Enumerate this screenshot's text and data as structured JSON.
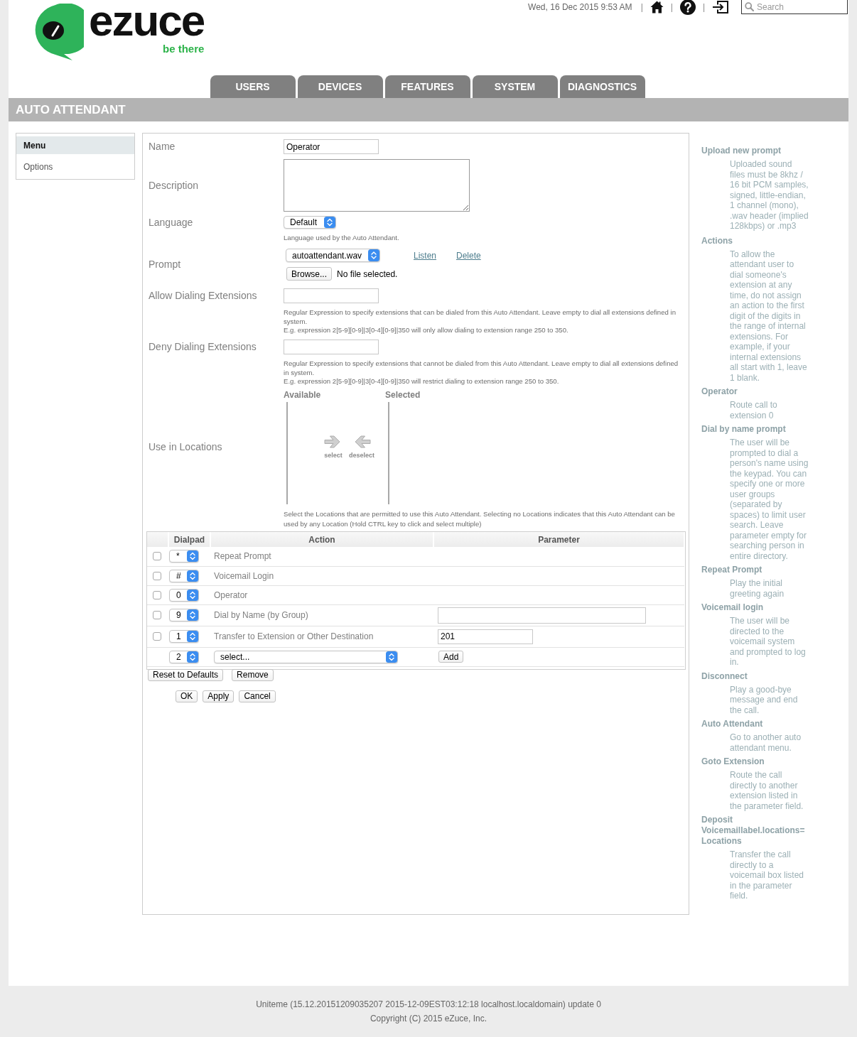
{
  "header": {
    "logo": {
      "wordmark": "ezuce",
      "tagline": "be there"
    },
    "datetime": "Wed, 16 Dec 2015 9:53 AM",
    "separators": [
      "|",
      "|",
      "|"
    ],
    "search": {
      "placeholder": "Search"
    }
  },
  "nav_tabs": [
    "USERS",
    "DEVICES",
    "FEATURES",
    "SYSTEM",
    "DIAGNOSTICS"
  ],
  "page_title": "AUTO ATTENDANT",
  "side_menu": [
    {
      "label": "Menu",
      "selected": true
    },
    {
      "label": "Options",
      "selected": false
    }
  ],
  "form": {
    "name": {
      "label": "Name",
      "value": "Operator"
    },
    "description": {
      "label": "Description"
    },
    "language": {
      "label": "Language",
      "value": "Default",
      "hint": "Language used by the Auto Attendant."
    },
    "prompt": {
      "label": "Prompt",
      "value": "autoattendant.wav",
      "links": [
        "Listen",
        "Delete"
      ],
      "browse_button": "Browse...",
      "file_status": "No file selected."
    },
    "allow_dialing_extensions": {
      "label": "Allow Dialing Extensions",
      "hint": [
        "Regular Expression to specify extensions that can be dialed from this Auto Attendant. Leave empty to dial all extensions defined in system.",
        "E.g. expression 2[5-9][0-9]|3[0-4][0-9]|350 will only allow dialing to extension range 250 to 350."
      ]
    },
    "deny_dialing_extensions": {
      "label": "Deny Dialing Extensions",
      "hint": [
        "Regular Expression to specify extensions that cannot be dialed from this Auto Attendant. Leave empty to dial all extensions defined in system.",
        "E.g. expression 2[5-9][0-9]|3[0-4][0-9]|350 will restrict dialing to extension range 250 to 350."
      ]
    },
    "locations": {
      "label": "Use in Locations",
      "available_heading": "Available",
      "selected_heading": "Selected",
      "select_button": "select",
      "deselect_button": "deselect",
      "hint": "Select the Locations that are permitted to use this Auto Attendant. Selecting no Locations indicates that this Auto Attendant can be used by any Location (Hold CTRL key to click and select multiple)"
    }
  },
  "dialpad_table": {
    "columns": [
      "Dialpad",
      "Action",
      "Parameter"
    ],
    "rows": [
      {
        "checked": false,
        "key": "*",
        "action": "Repeat Prompt",
        "kind": "plain"
      },
      {
        "checked": false,
        "key": "#",
        "action": "Voicemail Login",
        "kind": "plain"
      },
      {
        "checked": false,
        "key": "0",
        "action": "Operator",
        "kind": "plain"
      },
      {
        "checked": false,
        "key": "9",
        "action": "Dial by Name (by Group)",
        "kind": "groups"
      },
      {
        "checked": false,
        "key": "1",
        "action": "Transfer to Extension or Other Destination",
        "kind": "extension",
        "parameter": "201"
      }
    ],
    "new_entry": {
      "key": "2",
      "action": "select...",
      "add_button": "Add"
    },
    "buttons": [
      "Reset to Defaults",
      "Remove"
    ]
  },
  "form_buttons": [
    "OK",
    "Apply",
    "Cancel"
  ],
  "help": [
    {
      "title": "Upload new prompt",
      "text": "Uploaded sound files must be 8khz / 16 bit PCM samples, signed, little-endian, 1 channel (mono), .wav header (implied 128kbps) or .mp3"
    },
    {
      "title": "Actions",
      "text": "To allow the attendant user to dial someone's extension at any time, do not assign an action to the first digit of the digits in the range of internal extensions. For example, if your internal extensions all start with 1, leave 1 blank."
    },
    {
      "title": "Operator",
      "text": "Route call to extension 0"
    },
    {
      "title": "Dial by name prompt",
      "text": "The user will be prompted to dial a person's name using the keypad. You can specify one or more user groups (separated by spaces) to limit user search. Leave parameter empty for searching person in entire directory."
    },
    {
      "title": "Repeat Prompt",
      "text": "Play the initial greeting again"
    },
    {
      "title": "Voicemail login",
      "text": "The user will be directed to the voicemail system and prompted to log in."
    },
    {
      "title": "Disconnect",
      "text": "Play a good-bye message and end the call."
    },
    {
      "title": "Auto Attendant",
      "text": "Go to another auto attendant menu."
    },
    {
      "title": "Goto Extension",
      "text": "Route the call directly to another extension listed in the parameter field."
    },
    {
      "title": "Deposit Voicemaillabel.locations= Locations",
      "text": "Transfer the call directly to a voicemail box listed in the parameter field."
    }
  ],
  "footer": {
    "build": "Uniteme (15.12.20151209035207 2015-12-09EST03:12:18 localhost.localdomain) update 0",
    "copyright": "Copyright (C) 2015 eZuce, Inc."
  }
}
